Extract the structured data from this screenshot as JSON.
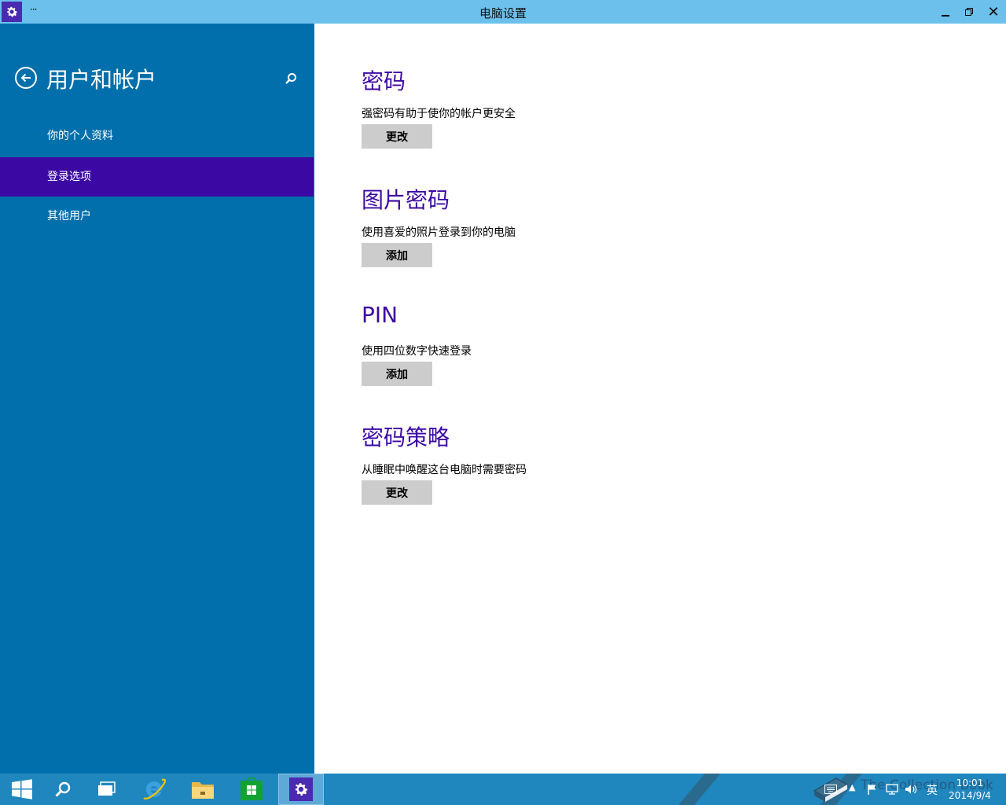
{
  "window": {
    "title": "电脑设置",
    "menu_glyph": "···"
  },
  "sidebar": {
    "title": "用户和帐户",
    "items": [
      {
        "label": "你的个人资料",
        "selected": false
      },
      {
        "label": "登录选项",
        "selected": true
      },
      {
        "label": "其他用户",
        "selected": false
      }
    ]
  },
  "sections": [
    {
      "heading": "密码",
      "description": "强密码有助于使你的帐户更安全",
      "button": "更改"
    },
    {
      "heading": "图片密码",
      "description": "使用喜爱的照片登录到你的电脑",
      "button": "添加"
    },
    {
      "heading": "PIN",
      "description": "使用四位数字快速登录",
      "button": "添加"
    },
    {
      "heading": "密码策略",
      "description": "从睡眠中唤醒这台电脑时需要密码",
      "button": "更改"
    }
  ],
  "taskbar": {
    "apps": [
      "start-icon",
      "search-icon",
      "task-view-icon",
      "internet-explorer-icon",
      "file-explorer-icon",
      "store-icon",
      "settings-icon"
    ],
    "tray": {
      "input_language": "英",
      "time": "10:01",
      "date": "2014/9/4"
    },
    "watermark": "The Collection Book"
  },
  "colors": {
    "titlebar": "#6cc0ec",
    "sidebar": "#006fab",
    "selected": "#3c08a4",
    "heading": "#3c08a4",
    "button": "#cccccc",
    "taskbar": "#1f86be"
  }
}
